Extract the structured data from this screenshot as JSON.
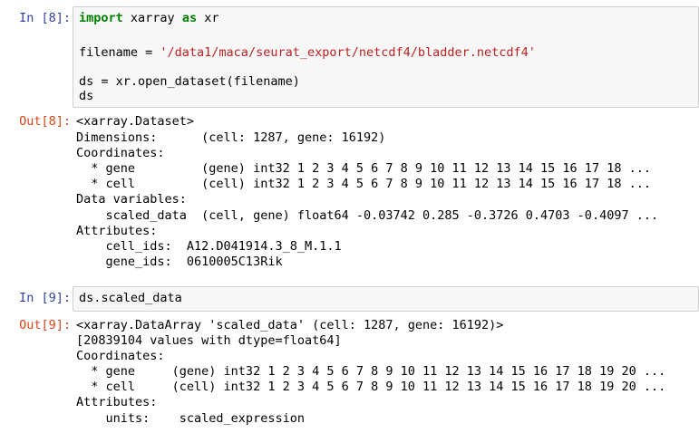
{
  "cells": [
    {
      "in_prompt": "In [8]:",
      "code": {
        "l1_kw1": "import",
        "l1_mid": " xarray ",
        "l1_kw2": "as",
        "l1_end": " xr",
        "l2_pre": "filename = ",
        "l2_str": "'/data1/maca/seurat_export/netcdf4/bladder.netcdf4'",
        "l3": "ds = xr.open_dataset(filename)",
        "l4": "ds"
      },
      "out_prompt": "Out[8]:",
      "output": [
        "<xarray.Dataset>",
        "Dimensions:      (cell: 1287, gene: 16192)",
        "Coordinates:",
        "  * gene         (gene) int32 1 2 3 4 5 6 7 8 9 10 11 12 13 14 15 16 17 18 ...",
        "  * cell         (cell) int32 1 2 3 4 5 6 7 8 9 10 11 12 13 14 15 16 17 18 ...",
        "Data variables:",
        "    scaled_data  (cell, gene) float64 -0.03742 0.285 -0.3726 0.4703 -0.4097 ...",
        "Attributes:",
        "    cell_ids:  A12.D041914.3_8_M.1.1",
        "    gene_ids:  0610005C13Rik"
      ]
    },
    {
      "in_prompt": "In [9]:",
      "code": {
        "l1": "ds.scaled_data"
      },
      "out_prompt": "Out[9]:",
      "output": [
        "<xarray.DataArray 'scaled_data' (cell: 1287, gene: 16192)>",
        "[20839104 values with dtype=float64]",
        "Coordinates:",
        "  * gene     (gene) int32 1 2 3 4 5 6 7 8 9 10 11 12 13 14 15 16 17 18 19 20 ...",
        "  * cell     (cell) int32 1 2 3 4 5 6 7 8 9 10 11 12 13 14 15 16 17 18 19 20 ...",
        "Attributes:",
        "    units:    scaled_expression"
      ]
    }
  ],
  "colors": {
    "in_prompt": "#303f9f",
    "out_prompt": "#d84315",
    "keyword": "#008000",
    "string": "#ba2121",
    "cell_bg": "#f7f7f7"
  }
}
